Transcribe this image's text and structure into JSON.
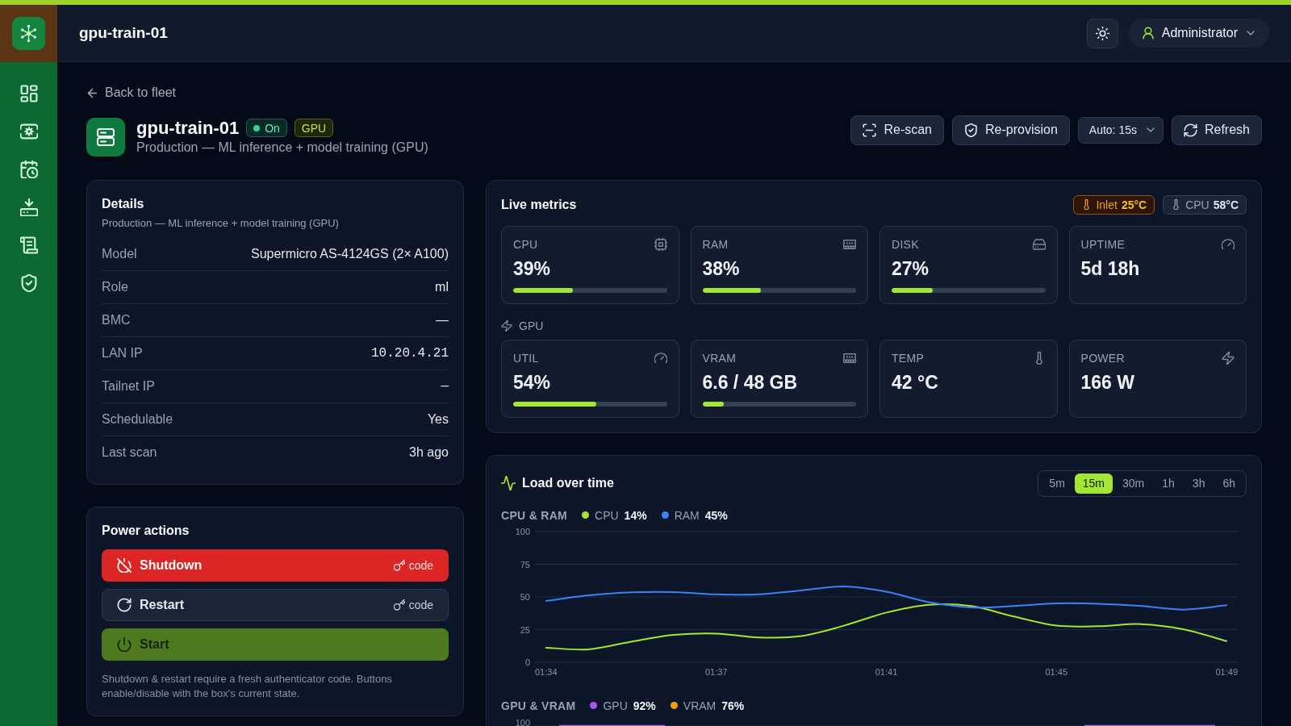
{
  "header": {
    "title": "gpu-train-01",
    "user": "Administrator"
  },
  "back_link": "Back to fleet",
  "host": {
    "name": "gpu-train-01",
    "badges": [
      {
        "label": "On",
        "kind": "status"
      },
      {
        "label": "GPU",
        "kind": "tag"
      }
    ],
    "description": "Production — ML inference + model training (GPU)"
  },
  "toolbar": [
    {
      "kind": "button",
      "label": "Re-scan"
    },
    {
      "kind": "button",
      "label": "Re-provision"
    },
    {
      "kind": "select",
      "value": "Auto: 15s"
    },
    {
      "kind": "button",
      "label": "Refresh"
    }
  ],
  "details": {
    "title": "Details",
    "subtitle": "Production — ML inference + model training (GPU)",
    "rows": [
      {
        "label": "Model",
        "value": "Supermicro AS-4124GS (2× A100)",
        "kind": "text"
      },
      {
        "label": "Role",
        "value": "ml",
        "kind": "text"
      },
      {
        "label": "BMC",
        "value": "—",
        "kind": "text"
      },
      {
        "label": "LAN IP",
        "value": "10.20.4.21",
        "kind": "mono"
      },
      {
        "label": "Tailnet IP",
        "value": "—",
        "kind": "mono"
      },
      {
        "label": "Schedulable",
        "value": "Yes",
        "kind": "text"
      },
      {
        "label": "Last scan",
        "value": "3h ago",
        "kind": "text"
      }
    ]
  },
  "power_actions": {
    "title": "Power actions",
    "buttons": [
      {
        "label": "Shutdown",
        "kind": "danger",
        "hint": "code",
        "disabled": false
      },
      {
        "label": "Restart",
        "kind": "neutral",
        "hint": "code",
        "disabled": false
      },
      {
        "label": "Start",
        "kind": "success",
        "disabled": true
      }
    ],
    "note": "Shutdown & restart require a fresh authenticator code. Buttons enable/disable with the box's current state."
  },
  "live_metrics": {
    "title": "Live metrics",
    "temperatures": [
      {
        "label": "Inlet",
        "value": "25°C",
        "kind": "warning"
      },
      {
        "label": "CPU",
        "value": "58°C",
        "kind": "normal"
      }
    ],
    "system": [
      {
        "label": "CPU",
        "value": "39%",
        "level": 0.39
      },
      {
        "label": "RAM",
        "value": "38%",
        "level": 0.38
      },
      {
        "label": "DISK",
        "value": "27%",
        "level": 0.27
      },
      {
        "label": "UPTIME",
        "value": "5d 18h"
      }
    ],
    "gpu_label": "GPU",
    "gpu": [
      {
        "label": "UTIL",
        "value": "54%",
        "level": 0.54
      },
      {
        "label": "VRAM",
        "value": "6.6 / 48 GB",
        "level": 0.1375
      },
      {
        "label": "TEMP",
        "value": "42 °C"
      },
      {
        "label": "POWER",
        "value": "166 W"
      }
    ]
  },
  "load": {
    "title": "Load over time",
    "ranges": [
      {
        "label": "5m",
        "selected": false
      },
      {
        "label": "15m",
        "selected": true
      },
      {
        "label": "30m",
        "selected": false
      },
      {
        "label": "1h",
        "selected": false
      },
      {
        "label": "3h",
        "selected": false
      },
      {
        "label": "6h",
        "selected": false
      }
    ],
    "charts": [
      {
        "title": "CPU & RAM",
        "legend_values": [
          "14%",
          "45%"
        ],
        "chart_data": {
          "type": "line",
          "categories": [
            "01:34",
            null,
            null,
            null,
            "01:37",
            null,
            null,
            null,
            "01:41",
            null,
            null,
            null,
            "01:45",
            null,
            null,
            null,
            "01:49"
          ],
          "ylim": [
            0,
            100
          ],
          "yticks": [
            0,
            25,
            50,
            75,
            100
          ],
          "grid": true,
          "series": [
            {
              "name": "CPU",
              "color": "#a3e635",
              "values": [
                11.2,
                9.9,
                15.8,
                20.9,
                22,
                19,
                20,
                28,
                38,
                44,
                43,
                35,
                28,
                27.6,
                29.2,
                25.1,
                16.2
              ]
            },
            {
              "name": "RAM",
              "color": "#3b82f6",
              "values": [
                47,
                51.3,
                53.5,
                53.7,
                52,
                52,
                55,
                58,
                54,
                46,
                42,
                43,
                45,
                44.8,
                43.1,
                40.3,
                43.7
              ]
            }
          ]
        }
      },
      {
        "title": "GPU & VRAM",
        "legend": [
          {
            "label": "GPU",
            "value": "92%",
            "color": "#a855f7"
          },
          {
            "label": "VRAM",
            "value": "76%",
            "color": "#f59e0b"
          }
        ],
        "y_tick_labels": [
          "100"
        ]
      }
    ]
  }
}
